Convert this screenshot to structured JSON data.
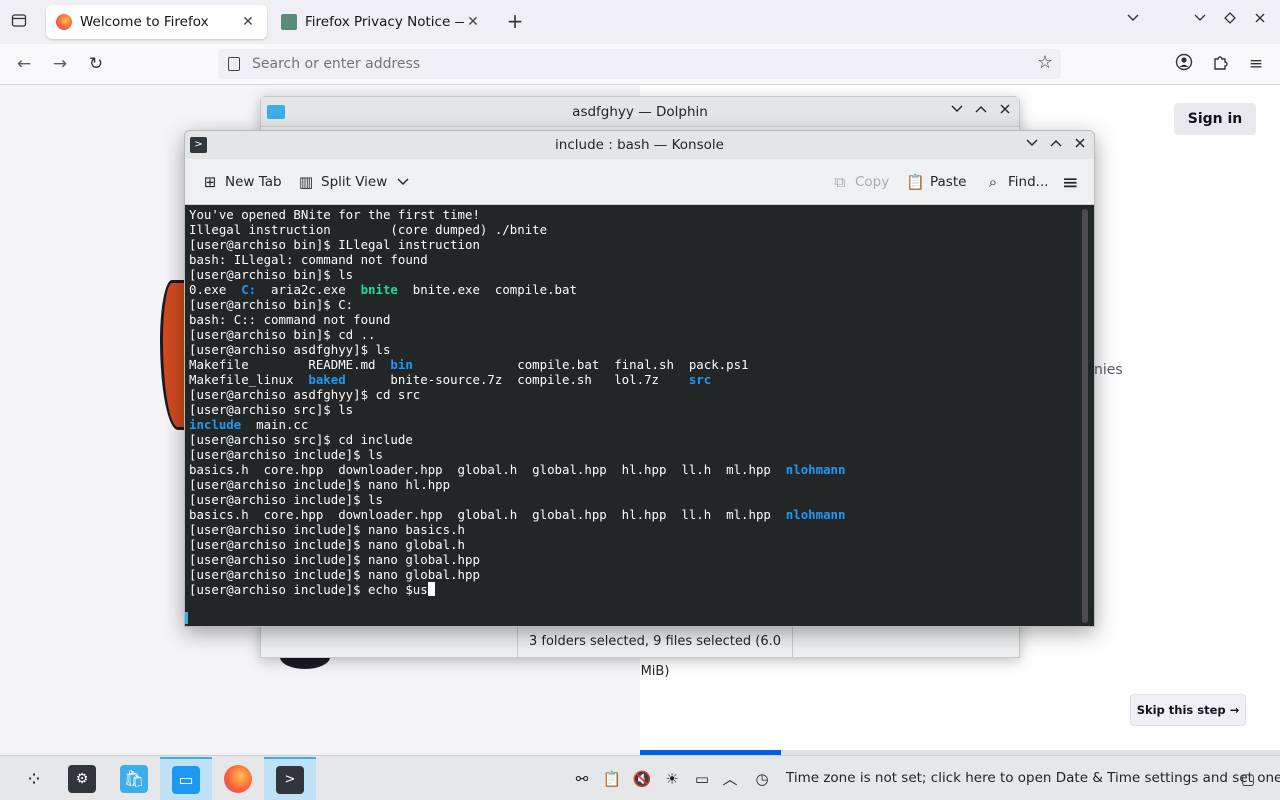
{
  "firefox": {
    "tabs": [
      {
        "title": "Welcome to Firefox",
        "close": "✕",
        "active": true
      },
      {
        "title": "Firefox Privacy Notice — M",
        "close": "✕",
        "active": false
      }
    ],
    "new_tab": "+",
    "urlbar_placeholder": "Search or enter address"
  },
  "page": {
    "sign_in": "Sign in",
    "text_fragment": "nies",
    "skip_button": "Skip this step →",
    "progress_fraction": 0.22
  },
  "dolphin": {
    "title": "asdfghyy — Dolphin",
    "status": "3 folders selected, 9 files selected (6.0 MiB)"
  },
  "konsole": {
    "title": "include : bash — Konsole",
    "toolbar": {
      "new_tab": "New Tab",
      "split_view": "Split View",
      "copy": "Copy",
      "paste": "Paste",
      "find": "Find..."
    },
    "lines": [
      [
        {
          "t": "You've opened BNite for the first time!"
        }
      ],
      [
        {
          "t": "Illegal instruction        (core dumped) ./bnite"
        }
      ],
      [
        {
          "t": "[user@archiso bin]$ ILlegal instruction"
        }
      ],
      [
        {
          "t": "bash: ILlegal: command not found"
        }
      ],
      [
        {
          "t": "[user@archiso bin]$ ls"
        }
      ],
      [
        {
          "t": "0.exe  "
        },
        {
          "t": "C:",
          "c": "dir"
        },
        {
          "t": "  aria2c.exe  "
        },
        {
          "t": "bnite",
          "c": "exe"
        },
        {
          "t": "  bnite.exe  compile.bat"
        }
      ],
      [
        {
          "t": "[user@archiso bin]$ C:"
        }
      ],
      [
        {
          "t": "bash: C:: command not found"
        }
      ],
      [
        {
          "t": "[user@archiso bin]$ cd .."
        }
      ],
      [
        {
          "t": "[user@archiso asdfghyy]$ ls"
        }
      ],
      [
        {
          "t": "Makefile        README.md  "
        },
        {
          "t": "bin",
          "c": "dir"
        },
        {
          "t": "              compile.bat  final.sh  pack.ps1"
        }
      ],
      [
        {
          "t": "Makefile_linux  "
        },
        {
          "t": "baked",
          "c": "dir"
        },
        {
          "t": "      bnite-source.7z  compile.sh   lol.7z    "
        },
        {
          "t": "src",
          "c": "dir"
        }
      ],
      [
        {
          "t": "[user@archiso asdfghyy]$ cd src"
        }
      ],
      [
        {
          "t": "[user@archiso src]$ ls"
        }
      ],
      [
        {
          "t": "include",
          "c": "dir"
        },
        {
          "t": "  main.cc"
        }
      ],
      [
        {
          "t": "[user@archiso src]$ cd include"
        }
      ],
      [
        {
          "t": "[user@archiso include]$ ls"
        }
      ],
      [
        {
          "t": "basics.h  core.hpp  downloader.hpp  global.h  global.hpp  hl.hpp  ll.h  ml.hpp  "
        },
        {
          "t": "nlohmann",
          "c": "dir"
        }
      ],
      [
        {
          "t": "[user@archiso include]$ nano hl.hpp"
        }
      ],
      [
        {
          "t": "[user@archiso include]$ ls"
        }
      ],
      [
        {
          "t": "basics.h  core.hpp  downloader.hpp  global.h  global.hpp  hl.hpp  ll.h  ml.hpp  "
        },
        {
          "t": "nlohmann",
          "c": "dir"
        }
      ],
      [
        {
          "t": "[user@archiso include]$ nano basics.h"
        }
      ],
      [
        {
          "t": "[user@archiso include]$ nano global.h"
        }
      ],
      [
        {
          "t": "[user@archiso include]$ nano global.hpp"
        }
      ],
      [
        {
          "t": "[user@archiso include]$ nano global.hpp"
        }
      ],
      [
        {
          "t": "[user@archiso include]$ echo $us"
        },
        {
          "c": "cursor"
        }
      ]
    ]
  },
  "taskbar": {
    "clock_status": "Time zone is not set; click here to open Date & Time settings and set one"
  }
}
